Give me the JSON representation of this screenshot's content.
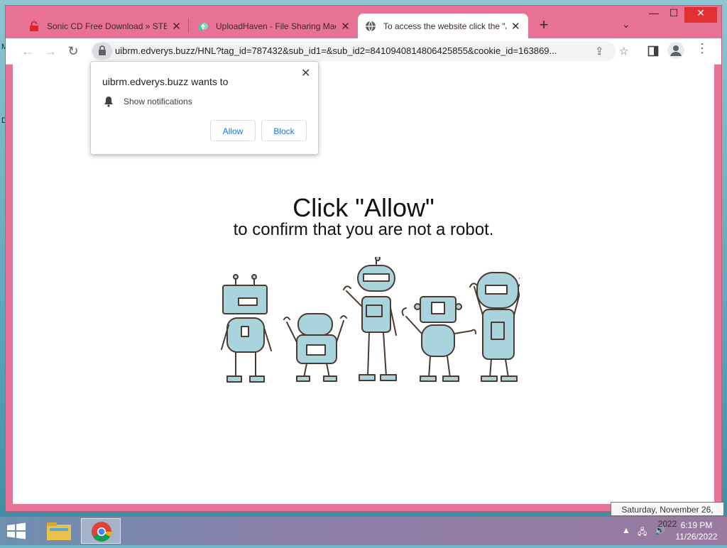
{
  "desktop": {
    "side_letters": [
      "M",
      "D"
    ]
  },
  "tabs": [
    {
      "title": "Sonic CD Free Download » STEAM",
      "favicon": "red-lock-icon"
    },
    {
      "title": "UploadHaven - File Sharing Made Simple",
      "favicon": "uploadhaven-icon"
    },
    {
      "title": "To access the website click the \"Allow\"",
      "favicon": "globe-icon"
    }
  ],
  "toolbar": {
    "url": "uibrm.edverys.buzz/HNL?tag_id=787432&sub_id1=&sub_id2=8410940814806425855&cookie_id=163869..."
  },
  "popup": {
    "title": "uibrm.edverys.buzz wants to",
    "permission": "Show notifications",
    "allow_label": "Allow",
    "block_label": "Block"
  },
  "page": {
    "headline": "Click \"Allow\"",
    "subline": "to confirm that you are not a robot."
  },
  "taskbar": {
    "time": "6:19 PM",
    "date": "11/26/2022",
    "tooltip": "Saturday, November 26, 2022"
  },
  "colors": {
    "window_frame": "#e87296",
    "accent_blue": "#1a73e8",
    "robot_fill": "#a9d3dd",
    "robot_stroke": "#4a3a30"
  }
}
